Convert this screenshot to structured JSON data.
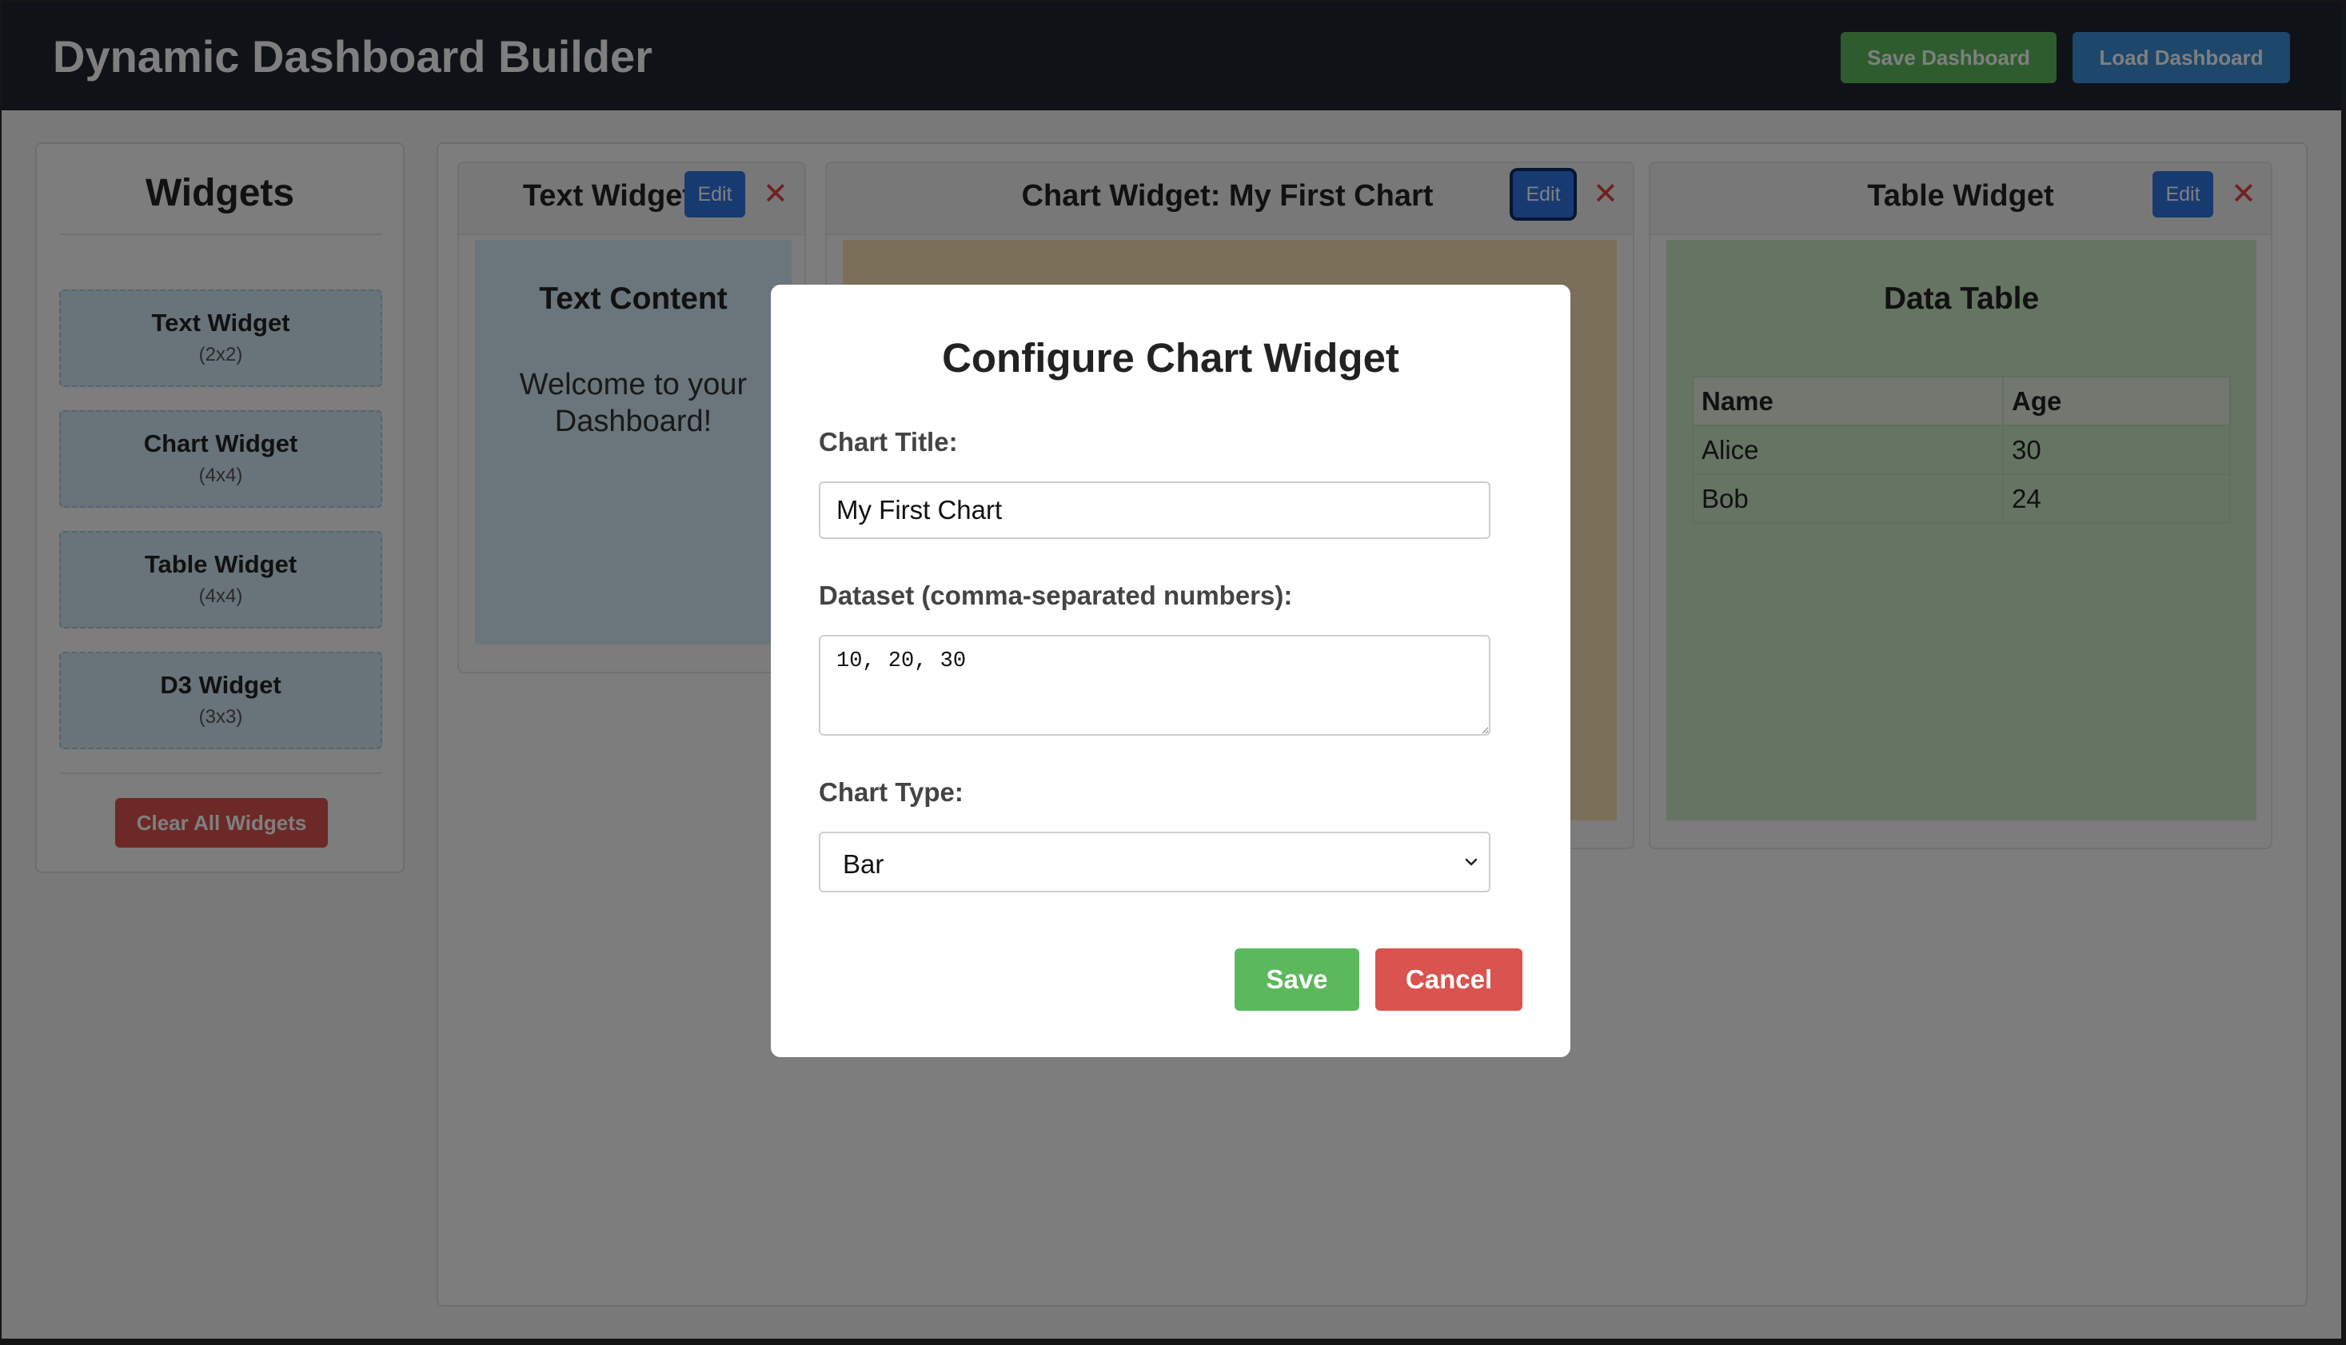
{
  "header": {
    "title": "Dynamic Dashboard Builder",
    "save_label": "Save Dashboard",
    "load_label": "Load Dashboard"
  },
  "sidebar": {
    "title": "Widgets",
    "items": [
      {
        "name": "Text Widget",
        "size": "(2x2)"
      },
      {
        "name": "Chart Widget",
        "size": "(4x4)"
      },
      {
        "name": "Table Widget",
        "size": "(4x4)"
      },
      {
        "name": "D3 Widget",
        "size": "(3x3)"
      }
    ],
    "clear_label": "Clear All Widgets"
  },
  "widgets": {
    "text": {
      "title": "Text Widget",
      "edit_label": "Edit",
      "close_glyph": "✕",
      "content_title": "Text Content",
      "content_text": "Welcome to your Dashboard!"
    },
    "chart": {
      "title": "Chart Widget: My First Chart",
      "edit_label": "Edit",
      "close_glyph": "✕"
    },
    "table": {
      "title": "Table Widget",
      "edit_label": "Edit",
      "close_glyph": "✕",
      "content_title": "Data Table",
      "columns": [
        "Name",
        "Age"
      ],
      "rows": [
        [
          "Alice",
          "30"
        ],
        [
          "Bob",
          "24"
        ]
      ]
    }
  },
  "modal": {
    "title": "Configure Chart Widget",
    "chart_title_label": "Chart Title:",
    "chart_title_value": "My First Chart",
    "dataset_label": "Dataset (comma-separated numbers):",
    "dataset_value": "10, 20, 30",
    "chart_type_label": "Chart Type:",
    "chart_type_value": "Bar",
    "save_label": "Save",
    "cancel_label": "Cancel"
  },
  "colors": {
    "header_bg": "#1f2630",
    "save_green": "#5cb85c",
    "load_blue": "#3a8fd6",
    "danger_red": "#d9534f",
    "edit_blue": "#2e76e0",
    "text_widget_bg": "#d4ecf6",
    "chart_widget_bg": "#f9dfb4",
    "table_widget_bg": "#cde9c9"
  }
}
